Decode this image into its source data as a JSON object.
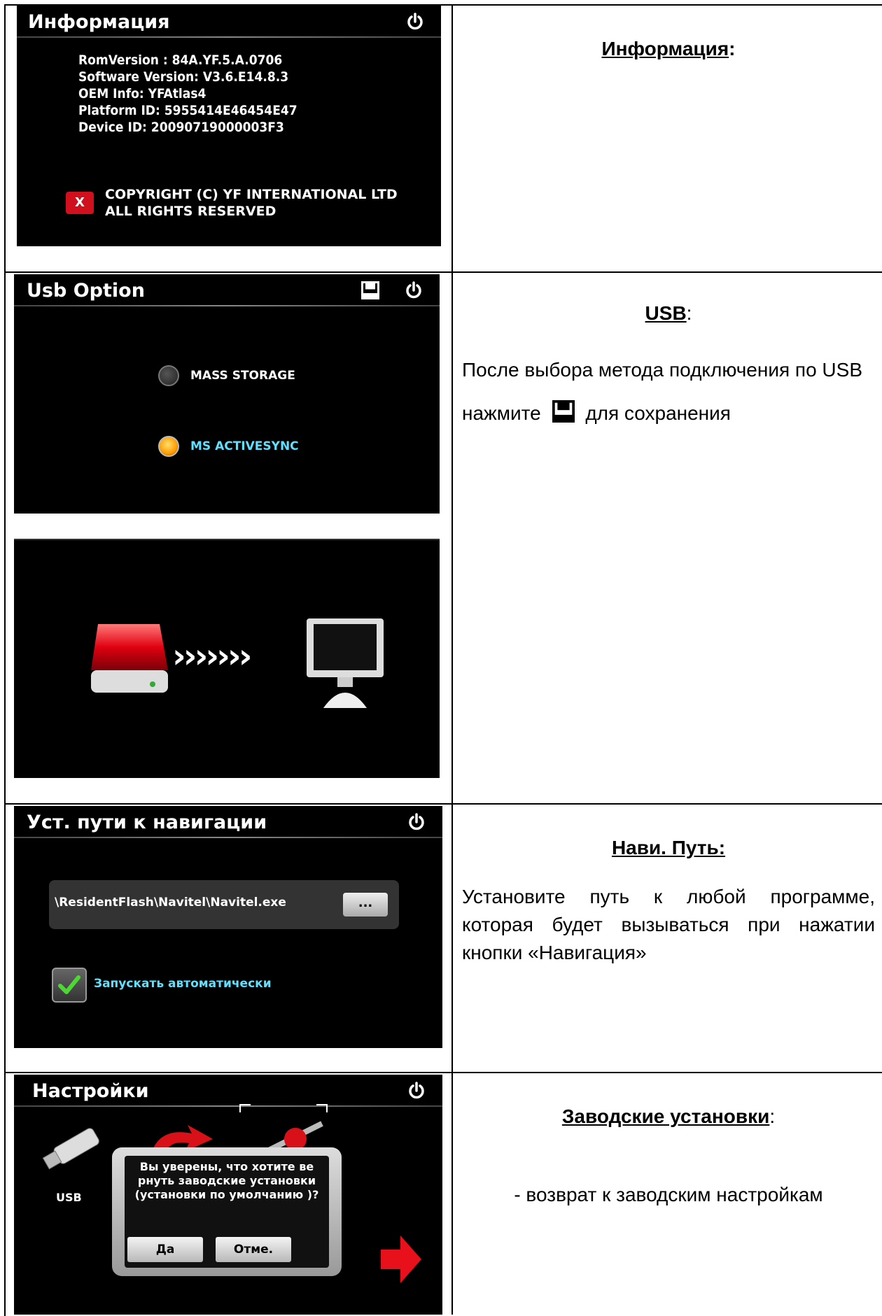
{
  "rows": [
    {
      "screen_title": "Информация",
      "info_lines": [
        "RomVersion : 84A.YF.5.A.0706",
        "Software Version: V3.6.E14.8.3",
        "OEM Info: YFAtlas4",
        "Platform ID: 5955414E46454E47",
        "Device ID: 20090719000003F3"
      ],
      "copyright_line1": "COPYRIGHT (C) YF INTERNATIONAL LTD",
      "copyright_line2": "ALL RIGHTS RESERVED",
      "heading": "Информация",
      "heading_suffix": ":"
    },
    {
      "screen_title": "Usb Option",
      "options": [
        {
          "label": "MASS STORAGE",
          "selected": false
        },
        {
          "label": "MS ACTIVESYNC",
          "selected": true
        }
      ],
      "arrows": "›››››››",
      "heading": "USB",
      "heading_suffix": ":",
      "text_before_icon": "После выбора метода подключения по USB нажмите",
      "text_after_icon": "для сохранения"
    },
    {
      "screen_title": "Уст. пути к навигации",
      "path_value": "\\ResidentFlash\\Navitel\\Navitel.exe",
      "browse_label": "...",
      "autostart_label": "Запускать автоматически",
      "autostart_checked": true,
      "heading": "Нави. Путь:",
      "text": "Установите путь к любой программе, которая будет вызываться при нажатии кнопки «Навигация»"
    },
    {
      "screen_title": "Настройки",
      "usb_label": "USB",
      "dialog_message": "Вы уверены, что хотите ве рнуть заводские установки (установки по умолчанию )?",
      "yes_label": "Да",
      "cancel_label": "Отме.",
      "heading": "Заводские установки",
      "heading_suffix": ":",
      "text": "- возврат к заводским настройкам"
    }
  ],
  "colors": {
    "screen_bg": "#000000",
    "accent_cyan": "#5fe0ff",
    "radio_on": "#ff9c00",
    "logo_red": "#d0101c"
  }
}
